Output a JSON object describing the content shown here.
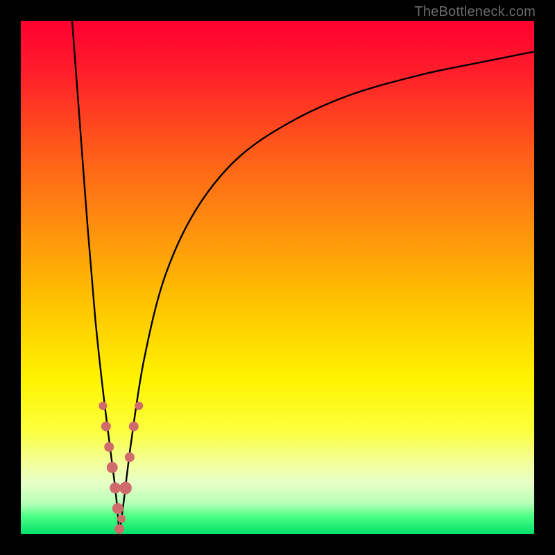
{
  "watermark": {
    "text": "TheBottleneck.com"
  },
  "colors": {
    "black": "#000000",
    "curve": "#000000",
    "markers": "#cf6b6b",
    "gradient_stops": [
      {
        "offset": 0.0,
        "color": "#ff0030"
      },
      {
        "offset": 0.1,
        "color": "#ff1e2a"
      },
      {
        "offset": 0.25,
        "color": "#ff5a1a"
      },
      {
        "offset": 0.4,
        "color": "#ff8f0e"
      },
      {
        "offset": 0.55,
        "color": "#ffc400"
      },
      {
        "offset": 0.7,
        "color": "#fff400"
      },
      {
        "offset": 0.8,
        "color": "#fcff40"
      },
      {
        "offset": 0.86,
        "color": "#f3ff9a"
      },
      {
        "offset": 0.9,
        "color": "#e8ffc8"
      },
      {
        "offset": 0.94,
        "color": "#b7ffb7"
      },
      {
        "offset": 0.965,
        "color": "#4dff85"
      },
      {
        "offset": 1.0,
        "color": "#00e06a"
      }
    ]
  },
  "chart_data": {
    "type": "line",
    "title": "",
    "xlabel": "",
    "ylabel": "",
    "xlim": [
      0,
      100
    ],
    "ylim": [
      0,
      100
    ],
    "grid": false,
    "legend": false,
    "series": [
      {
        "name": "left-branch",
        "x": [
          10.0,
          11.5,
          13.0,
          14.5,
          16.0,
          17.5,
          18.5,
          19.2
        ],
        "values": [
          100,
          80,
          60,
          42,
          28,
          16,
          8,
          0
        ]
      },
      {
        "name": "right-branch",
        "x": [
          19.2,
          20.0,
          21.5,
          24.0,
          28.0,
          34.0,
          42.0,
          52.0,
          64.0,
          78.0,
          90.0,
          100.0
        ],
        "values": [
          0,
          6,
          18,
          34,
          50,
          63,
          73,
          80,
          85.5,
          89.5,
          92,
          94
        ]
      }
    ],
    "markers": {
      "name": "highlighted-points",
      "x": [
        16.0,
        16.6,
        17.2,
        17.8,
        18.4,
        18.9,
        19.2,
        19.6,
        20.4,
        21.2,
        22.0,
        23.0
      ],
      "values": [
        25,
        21,
        17,
        13,
        9,
        5,
        1,
        3,
        9,
        15,
        21,
        25
      ],
      "radius": [
        6,
        7,
        7,
        8,
        8,
        8,
        7,
        6,
        9,
        7,
        7,
        6
      ]
    }
  }
}
